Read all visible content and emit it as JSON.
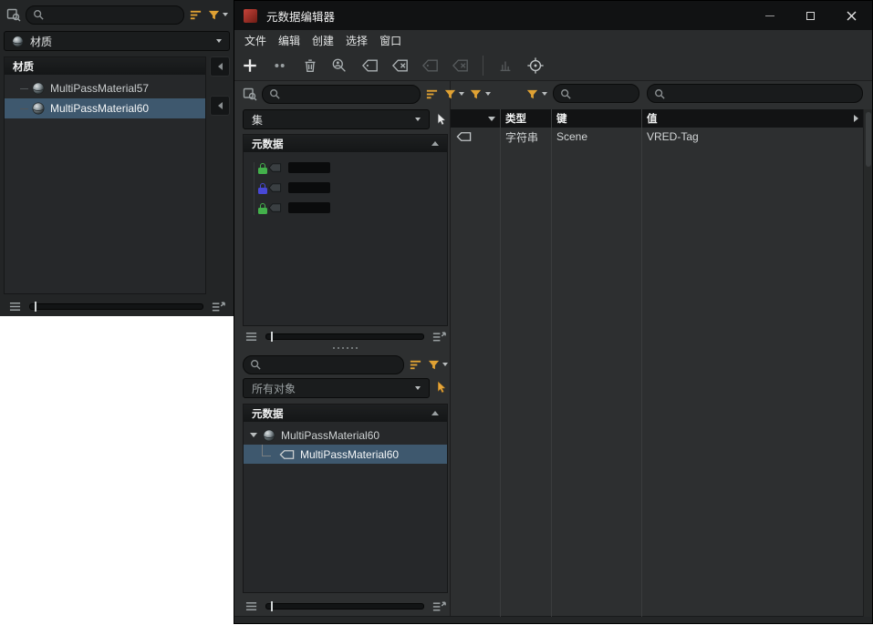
{
  "colors": {
    "accent_orange": "#dfa133",
    "selection_blue": "#3e586e",
    "lock_green": "#43b14b",
    "lock_blue": "#4848d6"
  },
  "icons": {
    "search": "magnifier",
    "find": "magnifier-over-square",
    "filter": "orange-funnel",
    "filter_list": "orange-sort-lines",
    "material": "shaded-sphere",
    "lock": "padlock",
    "tag": "label-tag",
    "pick_arrow": "cursor-arrow",
    "add": "plus",
    "delete": "trash-can",
    "target": "crosshair",
    "menu": "hamburger-lines"
  },
  "left_panel": {
    "search_placeholder": "",
    "type_dropdown": {
      "label": "材质"
    },
    "list": {
      "header": "材质",
      "items": [
        {
          "label": "MultiPassMaterial57",
          "selected": false
        },
        {
          "label": "MultiPassMaterial60",
          "selected": true
        }
      ]
    }
  },
  "window": {
    "title": "元数据编辑器",
    "menu": {
      "items": [
        {
          "label": "文件"
        },
        {
          "label": "编辑"
        },
        {
          "label": "创建"
        },
        {
          "label": "选择"
        },
        {
          "label": "窗口"
        }
      ]
    }
  },
  "sets_section": {
    "search_placeholder": "",
    "dropdown_label": "集",
    "panel_header": "元数据",
    "locked_items": [
      {
        "redacted": true,
        "lock_color": "#43b14b"
      },
      {
        "redacted": true,
        "lock_color": "#4848d6"
      },
      {
        "redacted": true,
        "lock_color": "#43b14b"
      }
    ]
  },
  "objects_section": {
    "search_placeholder": "",
    "dropdown_label": "所有对象",
    "panel_header": "元数据",
    "tree": {
      "parent_label": "MultiPassMaterial60",
      "child_label": "MultiPassMaterial60"
    }
  },
  "table": {
    "search_key_placeholder": "",
    "search_value_placeholder": "",
    "columns": [
      {
        "label": "类型"
      },
      {
        "label": "键"
      },
      {
        "label": "值"
      }
    ],
    "rows": [
      {
        "type": "字符串",
        "key": "Scene",
        "value": "VRED-Tag"
      }
    ]
  }
}
